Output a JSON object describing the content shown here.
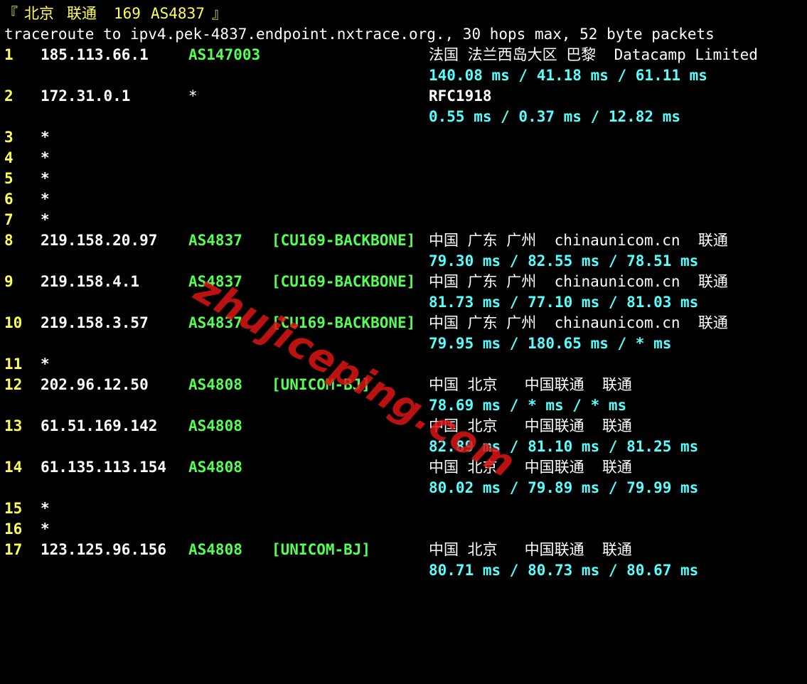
{
  "colors": {
    "background": "#000000",
    "hop_number": "#ffff54",
    "ip": "#ffffff",
    "asn": "#54ff54",
    "latency": "#54ffff",
    "watermark": "#dc1414"
  },
  "header": {
    "bracket_open": "『",
    "city": "北京",
    "isp": "联通",
    "code": "169",
    "asn": "AS4837",
    "bracket_close": "』"
  },
  "command_line": "traceroute to ipv4.pek-4837.endpoint.nxtrace.org., 30 hops max, 52 byte packets",
  "hops": {
    "h1": {
      "num": "1",
      "ip": "185.113.66.1",
      "asn": "AS147003",
      "geo": "法国 法兰西岛大区 巴黎  Datacamp Limited",
      "rtt": "140.08 ms / 41.18 ms / 61.11 ms"
    },
    "h2": {
      "num": "2",
      "ip": "172.31.0.1",
      "asn": "*",
      "geo": "RFC1918",
      "rtt": "0.55 ms / 0.37 ms / 12.82 ms"
    },
    "h3": {
      "num": "3",
      "star": "*"
    },
    "h4": {
      "num": "4",
      "star": "*"
    },
    "h5": {
      "num": "5",
      "star": "*"
    },
    "h6": {
      "num": "6",
      "star": "*"
    },
    "h7": {
      "num": "7",
      "star": "*"
    },
    "h8": {
      "num": "8",
      "ip": "219.158.20.97",
      "asn": "AS4837",
      "tag": "[CU169-BACKBONE]",
      "geo": "中国 广东 广州  chinaunicom.cn  联通",
      "rtt": "79.30 ms / 82.55 ms / 78.51 ms"
    },
    "h9": {
      "num": "9",
      "ip": "219.158.4.1",
      "asn": "AS4837",
      "tag": "[CU169-BACKBONE]",
      "geo": "中国 广东 广州  chinaunicom.cn  联通",
      "rtt": "81.73 ms / 77.10 ms / 81.03 ms"
    },
    "h10": {
      "num": "10",
      "ip": "219.158.3.57",
      "asn": "AS4837",
      "tag": "[CU169-BACKBONE]",
      "geo": "中国 广东 广州  chinaunicom.cn  联通",
      "rtt": "79.95 ms / 180.65 ms / * ms"
    },
    "h11": {
      "num": "11",
      "star": "*"
    },
    "h12": {
      "num": "12",
      "ip": "202.96.12.50",
      "asn": "AS4808",
      "tag": "[UNICOM-BJ]",
      "geo": "中国 北京   中国联通  联通",
      "rtt": "78.69 ms / * ms / * ms"
    },
    "h13": {
      "num": "13",
      "ip": "61.51.169.142",
      "asn": "AS4808",
      "geo": "中国 北京   中国联通  联通",
      "rtt": "82.89 ms / 81.10 ms / 81.25 ms"
    },
    "h14": {
      "num": "14",
      "ip": "61.135.113.154",
      "asn": "AS4808",
      "geo": "中国 北京   中国联通  联通",
      "rtt": "80.02 ms / 79.89 ms / 79.99 ms"
    },
    "h15": {
      "num": "15",
      "star": "*"
    },
    "h16": {
      "num": "16",
      "star": "*"
    },
    "h17": {
      "num": "17",
      "ip": "123.125.96.156",
      "asn": "AS4808",
      "tag": "[UNICOM-BJ]",
      "geo": "中国 北京   中国联通  联通",
      "rtt": "80.71 ms / 80.73 ms / 80.67 ms"
    }
  },
  "watermark": "zhujiceping.com"
}
